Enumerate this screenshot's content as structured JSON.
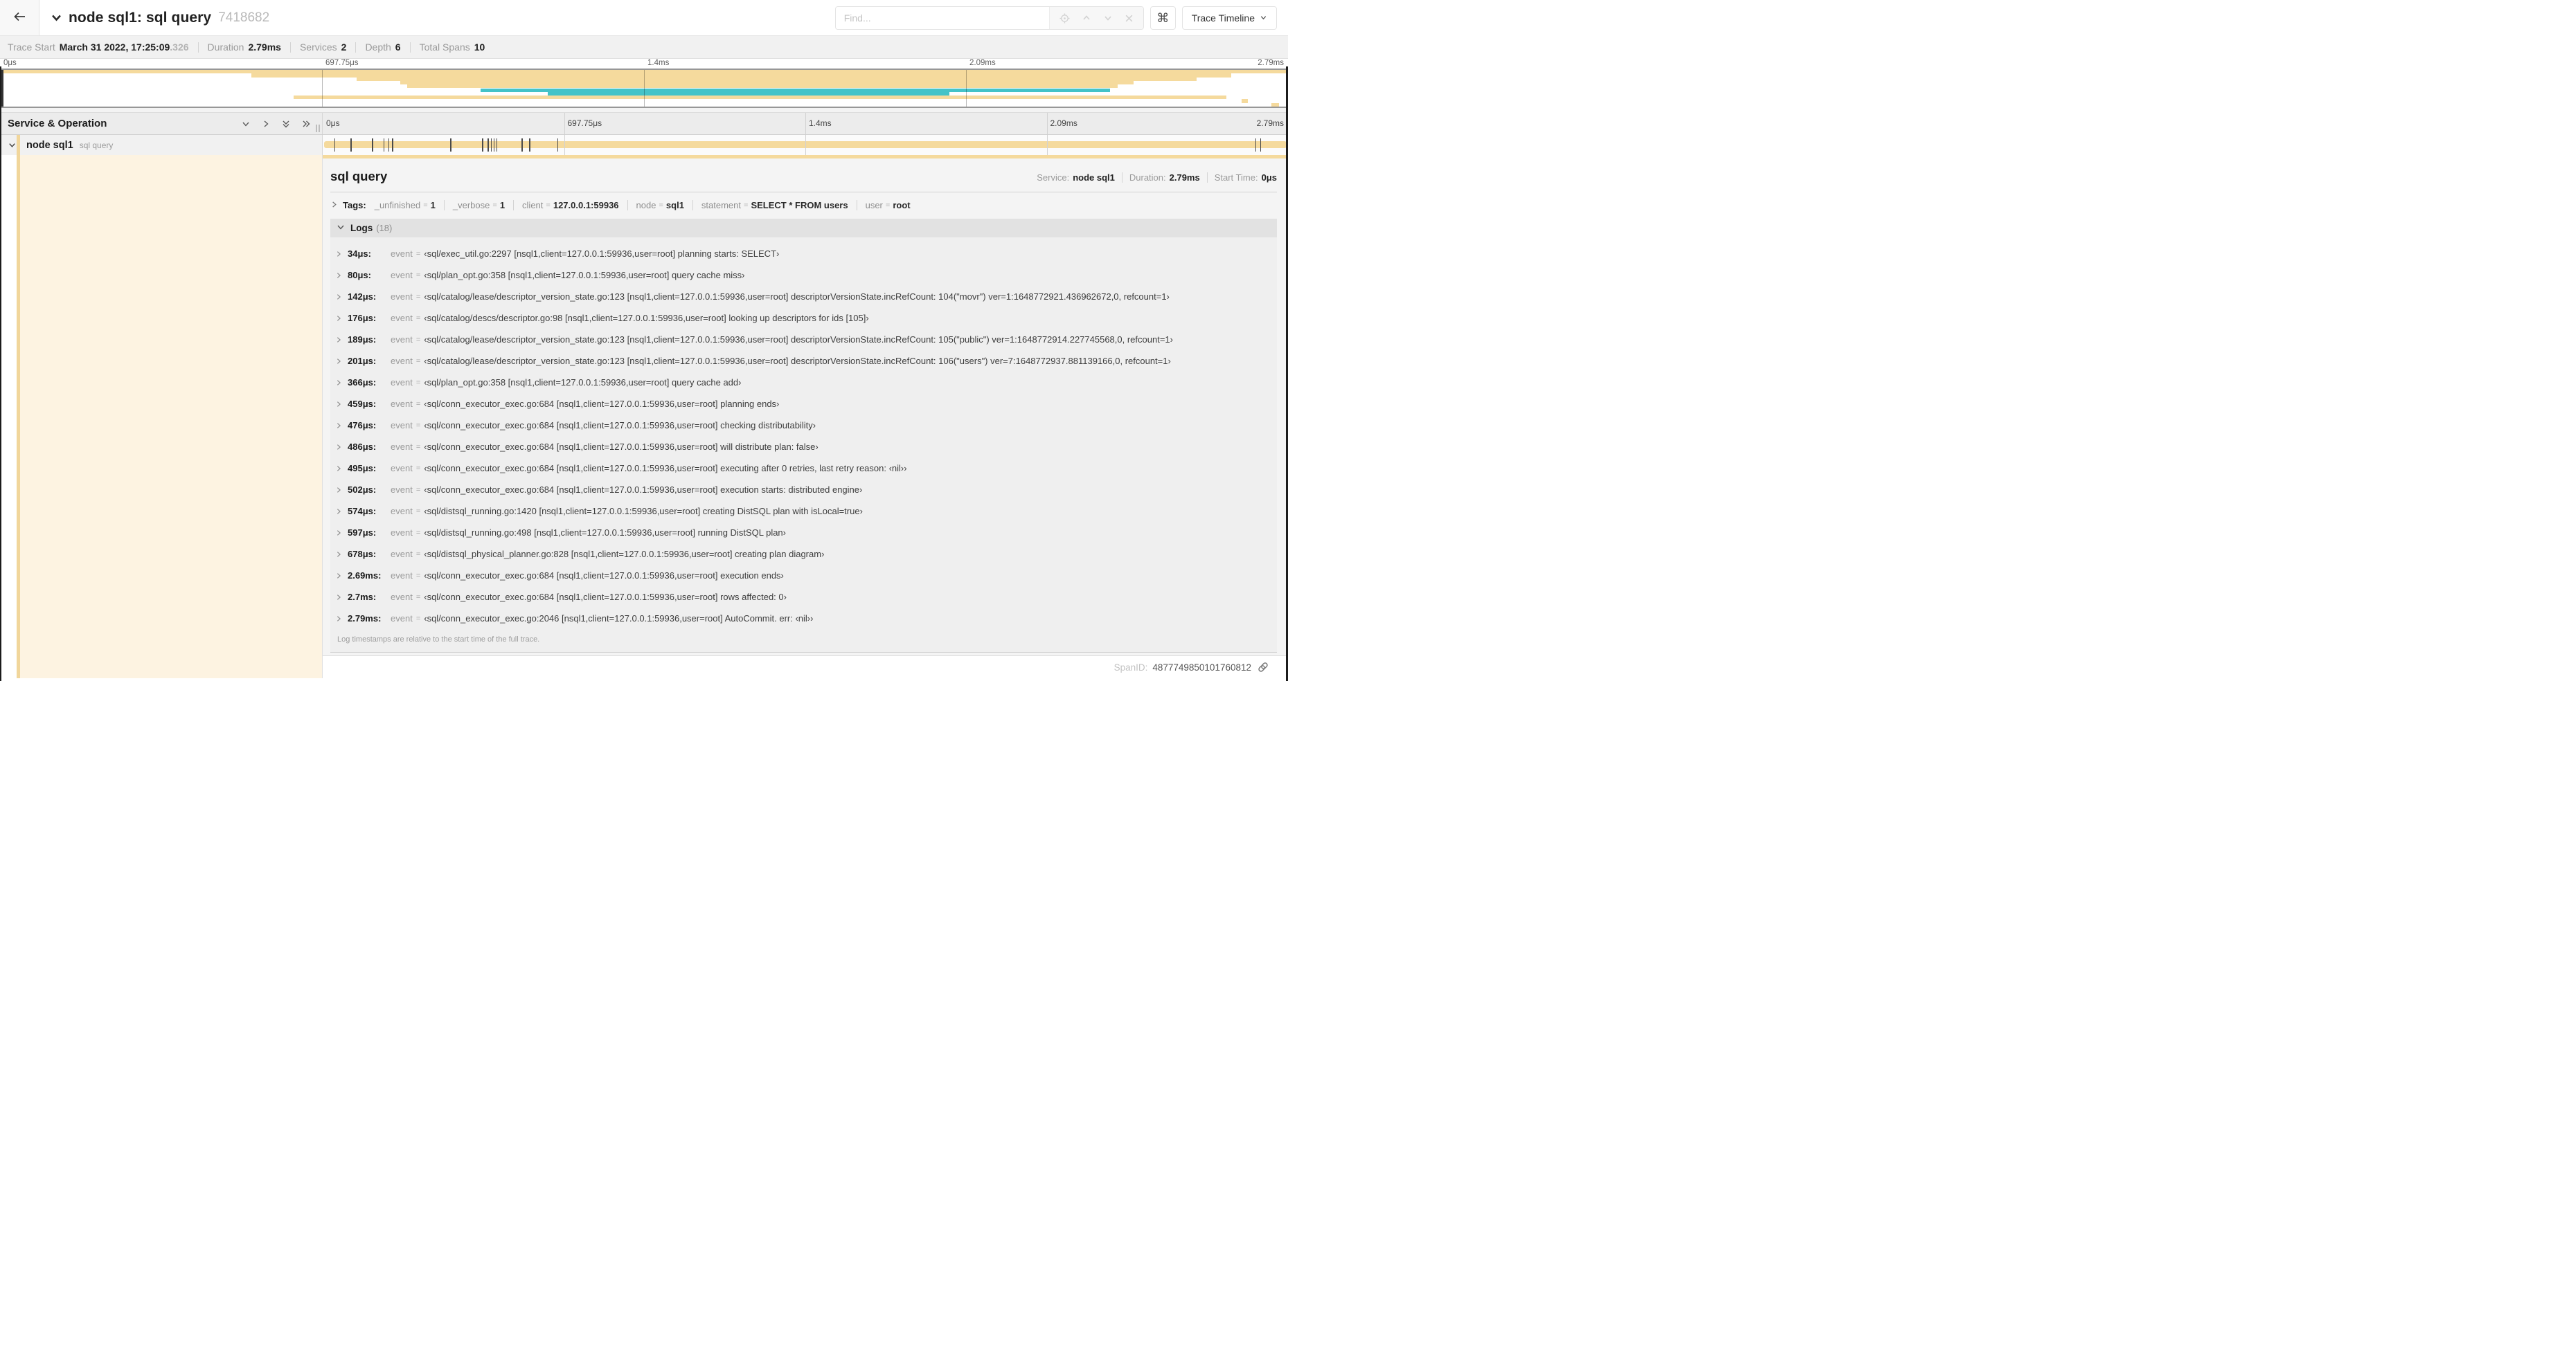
{
  "header": {
    "title": "node sql1: sql query",
    "trace_id": "7418682",
    "find_placeholder": "Find...",
    "shortcut_key": "⌘",
    "view_selector": "Trace Timeline"
  },
  "trace_info": {
    "items": [
      {
        "label": "Trace Start",
        "value": "March 31 2022, 17:25:09",
        "suffix": ".326"
      },
      {
        "label": "Duration",
        "value": "2.79ms"
      },
      {
        "label": "Services",
        "value": "2"
      },
      {
        "label": "Depth",
        "value": "6"
      },
      {
        "label": "Total Spans",
        "value": "10"
      }
    ]
  },
  "minimap": {
    "ticks": [
      "0μs",
      "697.75μs",
      "1.4ms",
      "2.09ms",
      "2.79ms"
    ],
    "colors": {
      "tan": "#f5da9d",
      "teal": "#45c3c8"
    },
    "spans": [
      {
        "start": 0,
        "end": 100,
        "color": "tan"
      },
      {
        "start": 19.5,
        "end": 95.6,
        "color": "tan"
      },
      {
        "start": 27.7,
        "end": 92.9,
        "color": "tan"
      },
      {
        "start": 31.1,
        "end": 88.0,
        "color": "tan"
      },
      {
        "start": 31.6,
        "end": 86.8,
        "color": "tan"
      },
      {
        "start": 37.3,
        "end": 86.2,
        "color": "teal"
      },
      {
        "start": 42.5,
        "end": 73.7,
        "color": "teal"
      },
      {
        "start": 22.8,
        "end": 95.2,
        "color": "tan"
      },
      {
        "start": 96.4,
        "end": 96.9,
        "color": "tan"
      },
      {
        "start": 98.7,
        "end": 99.3,
        "color": "tan"
      }
    ]
  },
  "timeline": {
    "left_header": "Service & Operation",
    "ticks": [
      "0μs",
      "697.75μs",
      "1.4ms",
      "2.09ms",
      "2.79ms"
    ],
    "row": {
      "service": "node sql1",
      "operation": "sql query"
    },
    "log_marker_pcts": [
      1.2,
      2.9,
      5.1,
      6.3,
      6.8,
      7.2,
      13.2,
      16.5,
      17.1,
      17.4,
      17.7,
      18.0,
      20.6,
      21.4,
      24.3,
      96.6,
      97.1,
      99.8
    ]
  },
  "detail": {
    "title": "sql query",
    "meta": [
      {
        "label": "Service:",
        "value": "node sql1"
      },
      {
        "label": "Duration:",
        "value": "2.79ms"
      },
      {
        "label": "Start Time:",
        "value": "0μs"
      }
    ],
    "tags_label": "Tags:",
    "tags": [
      {
        "key": "_unfinished",
        "value": "1"
      },
      {
        "key": "_verbose",
        "value": "1"
      },
      {
        "key": "client",
        "value": "127.0.0.1:59936"
      },
      {
        "key": "node",
        "value": "sql1"
      },
      {
        "key": "statement",
        "value": "SELECT * FROM users"
      },
      {
        "key": "user",
        "value": "root"
      }
    ],
    "logs_label": "Logs",
    "logs_count": "(18)",
    "log_key": "event",
    "logs": [
      {
        "time": "34μs:",
        "value": "‹sql/exec_util.go:2297 [nsql1,client=127.0.0.1:59936,user=root] planning starts: SELECT›"
      },
      {
        "time": "80μs:",
        "value": "‹sql/plan_opt.go:358 [nsql1,client=127.0.0.1:59936,user=root] query cache miss›"
      },
      {
        "time": "142μs:",
        "value": "‹sql/catalog/lease/descriptor_version_state.go:123 [nsql1,client=127.0.0.1:59936,user=root] descriptorVersionState.incRefCount: 104(\"movr\") ver=1:1648772921.436962672,0, refcount=1›"
      },
      {
        "time": "176μs:",
        "value": "‹sql/catalog/descs/descriptor.go:98 [nsql1,client=127.0.0.1:59936,user=root] looking up descriptors for ids [105]›"
      },
      {
        "time": "189μs:",
        "value": "‹sql/catalog/lease/descriptor_version_state.go:123 [nsql1,client=127.0.0.1:59936,user=root] descriptorVersionState.incRefCount: 105(\"public\") ver=1:1648772914.227745568,0, refcount=1›"
      },
      {
        "time": "201μs:",
        "value": "‹sql/catalog/lease/descriptor_version_state.go:123 [nsql1,client=127.0.0.1:59936,user=root] descriptorVersionState.incRefCount: 106(\"users\") ver=7:1648772937.881139166,0, refcount=1›"
      },
      {
        "time": "366μs:",
        "value": "‹sql/plan_opt.go:358 [nsql1,client=127.0.0.1:59936,user=root] query cache add›"
      },
      {
        "time": "459μs:",
        "value": "‹sql/conn_executor_exec.go:684 [nsql1,client=127.0.0.1:59936,user=root] planning ends›"
      },
      {
        "time": "476μs:",
        "value": "‹sql/conn_executor_exec.go:684 [nsql1,client=127.0.0.1:59936,user=root] checking distributability›"
      },
      {
        "time": "486μs:",
        "value": "‹sql/conn_executor_exec.go:684 [nsql1,client=127.0.0.1:59936,user=root] will distribute plan: false›"
      },
      {
        "time": "495μs:",
        "value": "‹sql/conn_executor_exec.go:684 [nsql1,client=127.0.0.1:59936,user=root] executing after 0 retries, last retry reason: ‹nil››"
      },
      {
        "time": "502μs:",
        "value": "‹sql/conn_executor_exec.go:684 [nsql1,client=127.0.0.1:59936,user=root] execution starts: distributed engine›"
      },
      {
        "time": "574μs:",
        "value": "‹sql/distsql_running.go:1420 [nsql1,client=127.0.0.1:59936,user=root] creating DistSQL plan with isLocal=true›"
      },
      {
        "time": "597μs:",
        "value": "‹sql/distsql_running.go:498 [nsql1,client=127.0.0.1:59936,user=root] running DistSQL plan›"
      },
      {
        "time": "678μs:",
        "value": "‹sql/distsql_physical_planner.go:828 [nsql1,client=127.0.0.1:59936,user=root] creating plan diagram›"
      },
      {
        "time": "2.69ms:",
        "value": "‹sql/conn_executor_exec.go:684 [nsql1,client=127.0.0.1:59936,user=root] execution ends›"
      },
      {
        "time": "2.7ms:",
        "value": "‹sql/conn_executor_exec.go:684 [nsql1,client=127.0.0.1:59936,user=root] rows affected: 0›"
      },
      {
        "time": "2.79ms:",
        "value": "‹sql/conn_executor_exec.go:2046 [nsql1,client=127.0.0.1:59936,user=root] AutoCommit. err: ‹nil››"
      }
    ],
    "note": "Log timestamps are relative to the start time of the full trace.",
    "span_id_label": "SpanID:",
    "span_id": "4877749850101760812"
  }
}
